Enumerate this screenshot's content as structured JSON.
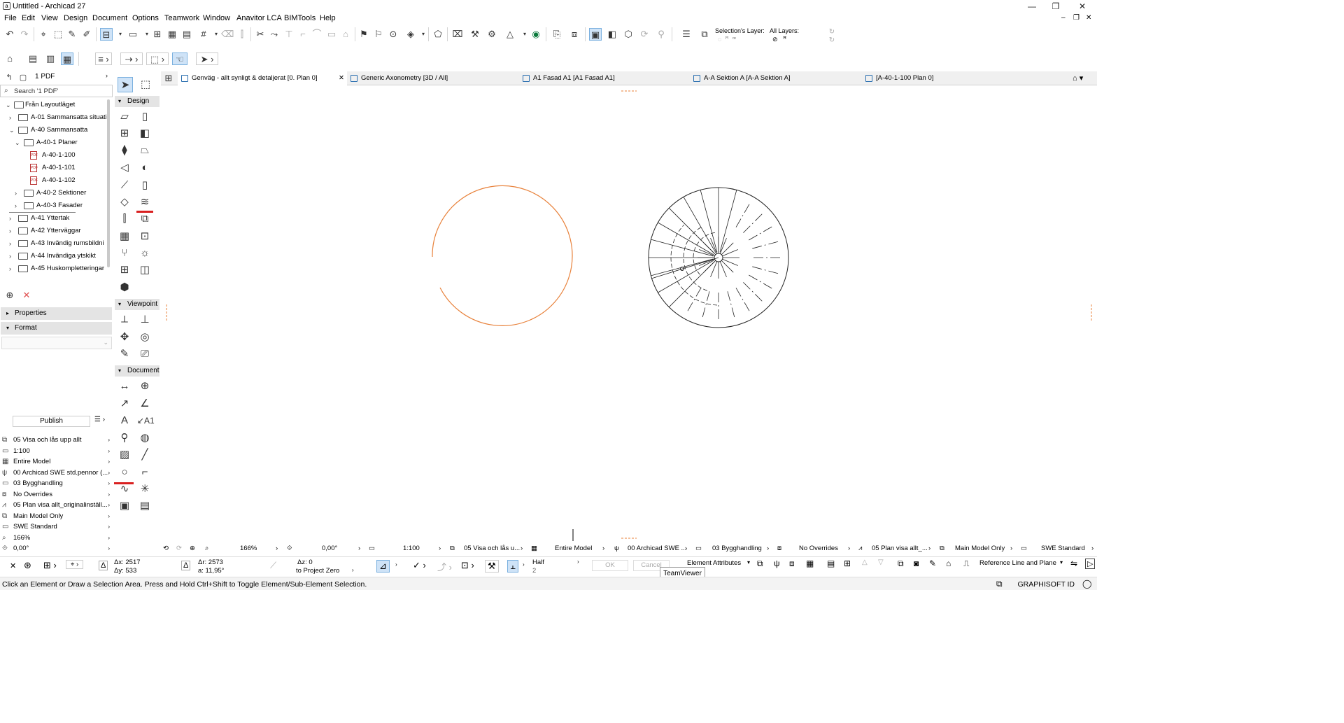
{
  "app": {
    "title": "Untitled - Archicad 27"
  },
  "menu": [
    "File",
    "Edit",
    "View",
    "Design",
    "Document",
    "Options",
    "Teamwork",
    "Window",
    "Anavitor LCA",
    "BIMTools",
    "Help"
  ],
  "toolbar": {
    "selection_layer_label": "Selection's Layer:",
    "all_layers_label": "All Layers:"
  },
  "navigator": {
    "set_name": "1 PDF",
    "search_placeholder": "Search '1 PDF'",
    "items": [
      {
        "label": "Från Layoutläget",
        "kind": "root"
      },
      {
        "label": "A-01 Sammansatta situati",
        "kind": "folder"
      },
      {
        "label": "A-40 Sammansatta",
        "kind": "folder"
      },
      {
        "label": "A-40-1 Planer",
        "kind": "folder"
      },
      {
        "label": "A-40-1-100",
        "kind": "pdf"
      },
      {
        "label": "A-40-1-101",
        "kind": "pdf"
      },
      {
        "label": "A-40-1-102",
        "kind": "pdf"
      },
      {
        "label": "A-40-2 Sektioner",
        "kind": "folder"
      },
      {
        "label": "A-40-3 Fasader",
        "kind": "folder"
      },
      {
        "label": "A-41 Yttertak",
        "kind": "folder"
      },
      {
        "label": "A-42 Ytterväggar",
        "kind": "folder"
      },
      {
        "label": "A-43 Invändig rumsbildni",
        "kind": "folder"
      },
      {
        "label": "A-44 Invändiga ytskikt",
        "kind": "folder"
      },
      {
        "label": "A-45 Huskompletteringar",
        "kind": "folder"
      }
    ]
  },
  "panels": {
    "properties": "Properties",
    "format": "Format"
  },
  "publish_label": "Publish",
  "quick_options": [
    {
      "icon": "layers-icon",
      "label": "05 Visa och lås upp allt"
    },
    {
      "icon": "scale-icon",
      "label": "1:100"
    },
    {
      "icon": "structure-icon",
      "label": "Entire Model"
    },
    {
      "icon": "pen-icon",
      "label": "00 Archicad SWE std.pennor (..."
    },
    {
      "icon": "model-view-icon",
      "label": "03 Bygghandling"
    },
    {
      "icon": "override-icon",
      "label": "No Overrides"
    },
    {
      "icon": "renovation-icon",
      "label": "05 Plan visa allt_originalinställ..."
    },
    {
      "icon": "partial-structure-icon",
      "label": "Main Model Only"
    },
    {
      "icon": "dimension-icon",
      "label": "SWE Standard"
    },
    {
      "icon": "zoom-icon",
      "label": "166%"
    },
    {
      "icon": "rotation-icon",
      "label": "0,00°"
    }
  ],
  "toolbox": {
    "design": "Design",
    "viewpoint": "Viewpoint",
    "document": "Document"
  },
  "tabs": [
    {
      "label": "Genväg - allt synligt & detaljerat [0. Plan 0]",
      "active": true
    },
    {
      "label": "Generic Axonometry [3D / All]",
      "active": false
    },
    {
      "label": "A1 Fasad A1 [A1 Fasad A1]",
      "active": false
    },
    {
      "label": "A-A Sektion A [A-A Sektion A]",
      "active": false
    },
    {
      "label": "[A-40-1-100 Plan 0]",
      "active": false
    }
  ],
  "navbar": {
    "zoom": "166%",
    "angle": "0,00°",
    "scale": "1:100",
    "layers": "05 Visa och lås u...",
    "structure": "Entire Model",
    "pen": "00 Archicad SWE ...",
    "model_view": "03 Bygghandling",
    "overrides": "No Overrides",
    "renovation": "05 Plan visa allt_...",
    "partial": "Main Model Only",
    "dimension": "SWE Standard"
  },
  "infobox": {
    "dx": "Δx: 2517",
    "dy": "Δy: 533",
    "dr": "Δr: 2573",
    "da": "a: 11,95°",
    "dz": "Δz: 0",
    "to_project_zero": "to Project Zero",
    "half": "Half",
    "half_value": "2",
    "ok": "OK",
    "cancel": "Cancel",
    "element_attributes": "Element Attributes",
    "reference_line": "Reference Line and Plane"
  },
  "status": {
    "message": "Click an Element or Draw a Selection Area. Press and Hold Ctrl+Shift to Toggle Element/Sub-Element Selection.",
    "graphisoft_id": "GRAPHISOFT ID"
  },
  "tooltip": "TeamViewer",
  "colors": {
    "accent": "#2a6fb0",
    "arc": "#e8813a",
    "selection": "#cfe3f7",
    "red_mark": "#d92020"
  }
}
